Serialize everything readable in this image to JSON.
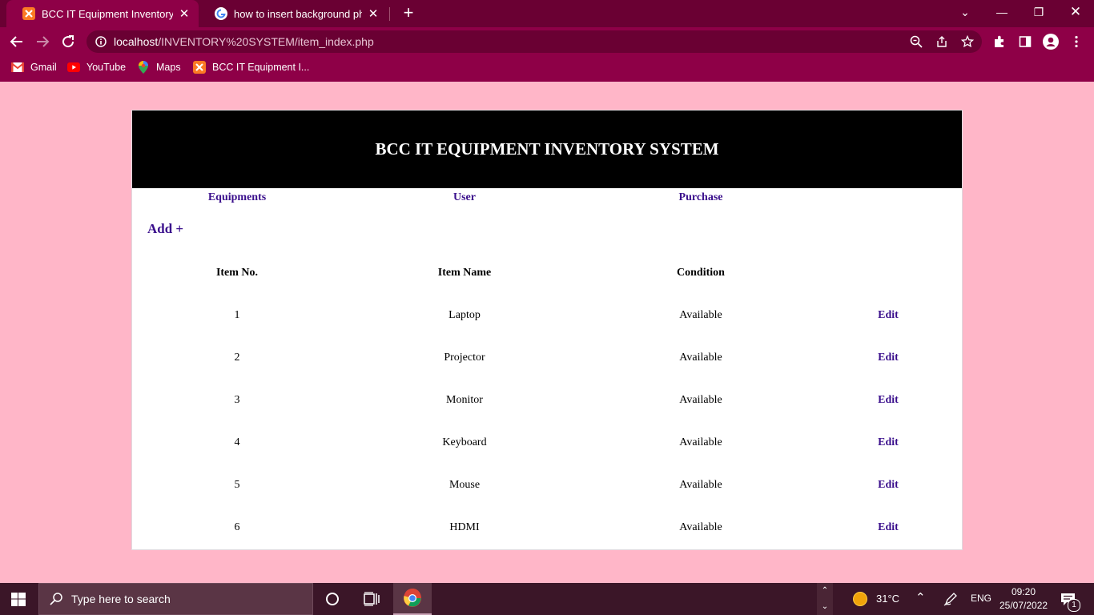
{
  "browser": {
    "tabs": [
      {
        "title": "BCC IT Equipment Inventory Syst",
        "active": true,
        "favicon": "xampp-icon"
      },
      {
        "title": "how to insert background photo",
        "active": false,
        "favicon": "google-icon"
      }
    ],
    "url_host": "localhost",
    "url_path": "/INVENTORY%20SYSTEM/item_index.php",
    "bookmarks": [
      {
        "label": "Gmail",
        "icon": "gmail-icon"
      },
      {
        "label": "YouTube",
        "icon": "youtube-icon"
      },
      {
        "label": "Maps",
        "icon": "maps-icon"
      },
      {
        "label": "BCC IT Equipment I...",
        "icon": "xampp-icon"
      }
    ]
  },
  "page": {
    "title": "BCC IT EQUIPMENT INVENTORY SYSTEM",
    "nav": {
      "equipments": "Equipments",
      "user": "User",
      "purchase": "Purchase"
    },
    "add_label": "Add +",
    "table": {
      "headers": {
        "item_no": "Item No.",
        "item_name": "Item Name",
        "condition": "Condition"
      },
      "rows": [
        {
          "no": "1",
          "name": "Laptop",
          "condition": "Available",
          "action": "Edit"
        },
        {
          "no": "2",
          "name": "Projector",
          "condition": "Available",
          "action": "Edit"
        },
        {
          "no": "3",
          "name": "Monitor",
          "condition": "Available",
          "action": "Edit"
        },
        {
          "no": "4",
          "name": "Keyboard",
          "condition": "Available",
          "action": "Edit"
        },
        {
          "no": "5",
          "name": "Mouse",
          "condition": "Available",
          "action": "Edit"
        },
        {
          "no": "6",
          "name": "HDMI",
          "condition": "Available",
          "action": "Edit"
        }
      ]
    }
  },
  "taskbar": {
    "search_placeholder": "Type here to search",
    "weather": "31°C",
    "language": "ENG",
    "time": "09:20",
    "date": "25/07/2022",
    "notification_count": "1"
  },
  "colors": {
    "page_background": "#ffb6c8",
    "browser_frame": "#8e0047",
    "link": "#3a0f8c",
    "header_background": "#000000"
  }
}
